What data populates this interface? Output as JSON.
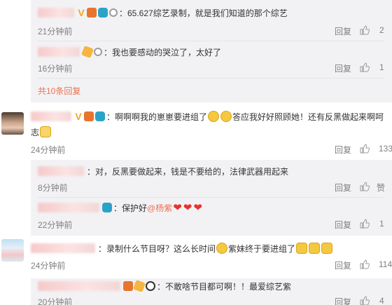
{
  "comments": {
    "r1": {
      "text": "：65.627综艺录制，就是我们知道的那个综艺",
      "time": "21分钟前",
      "reply": "回复",
      "likes": "2"
    },
    "r2": {
      "text": "：我也要感动的哭泣了，太好了",
      "time": "16分钟前",
      "reply": "回复",
      "likes": "1"
    },
    "more": "共10条回复",
    "c1": {
      "text_a": "：啊啊啊我的崽崽要进组了",
      "text_b": "答应我好好照顾她！还有反黑做起来啊呵",
      "text_c": "志",
      "time": "24分钟前",
      "reply": "回复",
      "likes": "133"
    },
    "r3": {
      "text": "：对，反黑要做起来，钱是不要给的，法律武器用起来",
      "time": "8分钟前",
      "reply": "回复",
      "like_label": "赞"
    },
    "r4": {
      "text_a": "：保护好",
      "mention": "@杨紫",
      "time": "22分钟前",
      "reply": "回复",
      "likes": "1"
    },
    "c2": {
      "text_a": "：录制什么节目呀？这么长时间",
      "text_b": "紫妹终于要进组了",
      "time": "24分钟前",
      "reply": "回复",
      "likes": "114"
    },
    "r5": {
      "text": "：不敢啥节目都可啊！！最爱综艺紫",
      "time": "20分钟前",
      "reply": "回复",
      "likes": "4"
    }
  },
  "icons": {
    "like": "thumb-up-icon",
    "vip": "vip-badge-icon",
    "verified": "v-icon",
    "emoji": "emoji-icon",
    "heart": "heart-icon"
  },
  "colors": {
    "accent": "#eb7350",
    "muted": "#808080",
    "reply_bg": "#f2f2f5"
  }
}
